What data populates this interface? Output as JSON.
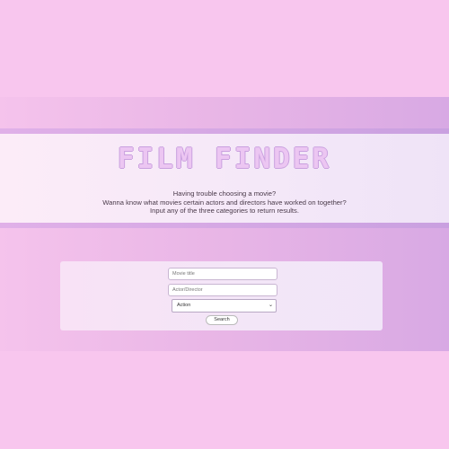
{
  "header": {
    "title": "FILM FINDER",
    "description": [
      "Having trouble choosing a movie?",
      "Wanna know what movies certain actors and directors have worked on together?",
      "Input any of the three categories to return results."
    ]
  },
  "form": {
    "movie_title": {
      "placeholder": "Movie title",
      "value": ""
    },
    "actor_director": {
      "placeholder": "Actor/Director",
      "value": ""
    },
    "genre_select": {
      "selected": "Action"
    },
    "search_label": "Search"
  },
  "colors": {
    "background": "#f8c6ee",
    "header_band": "#d8a9e4",
    "title_outline": "#c9a0df"
  }
}
